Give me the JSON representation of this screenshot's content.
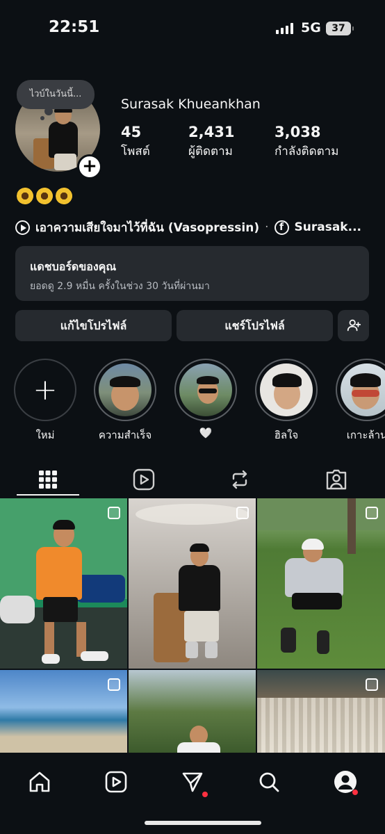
{
  "status_bar": {
    "time": "22:51",
    "network": "5G",
    "battery": "37"
  },
  "profile": {
    "username": "Surasak Khueankhan",
    "note_bubble": "ไวบ์ในวันนี้...",
    "stats": [
      {
        "value": "45",
        "label": "โพสต์"
      },
      {
        "value": "2,431",
        "label": "ผู้ติดตาม"
      },
      {
        "value": "3,038",
        "label": "กำลังติดตาม"
      }
    ],
    "bio_emoji": "🌻🌻🌻",
    "music_text": "เอาความเสียใจมาไว้ที่ฉัน (Vasopressin)",
    "separator": "·",
    "facebook_text": "Surasak..."
  },
  "dashboard": {
    "title": "แดชบอร์ดของคุณ",
    "subtitle": "ยอดดู 2.9 หมื่น ครั้งในช่วง 30 วันที่ผ่านมา"
  },
  "buttons": {
    "edit_profile": "แก้ไขโปรไฟล์",
    "share_profile": "แชร์โปรไฟล์"
  },
  "highlights": [
    {
      "label": "ใหม่"
    },
    {
      "label": "ความสำเร็จ"
    },
    {
      "label": "🤍"
    },
    {
      "label": "ฮิลใจ"
    },
    {
      "label": "เกาะล้าน"
    }
  ],
  "tabs": [
    "grid-icon",
    "reels-icon",
    "reposts-icon",
    "tagged-icon"
  ],
  "colors": {
    "background": "#0c1014",
    "card": "#262a2f",
    "notification": "#ff3040"
  }
}
